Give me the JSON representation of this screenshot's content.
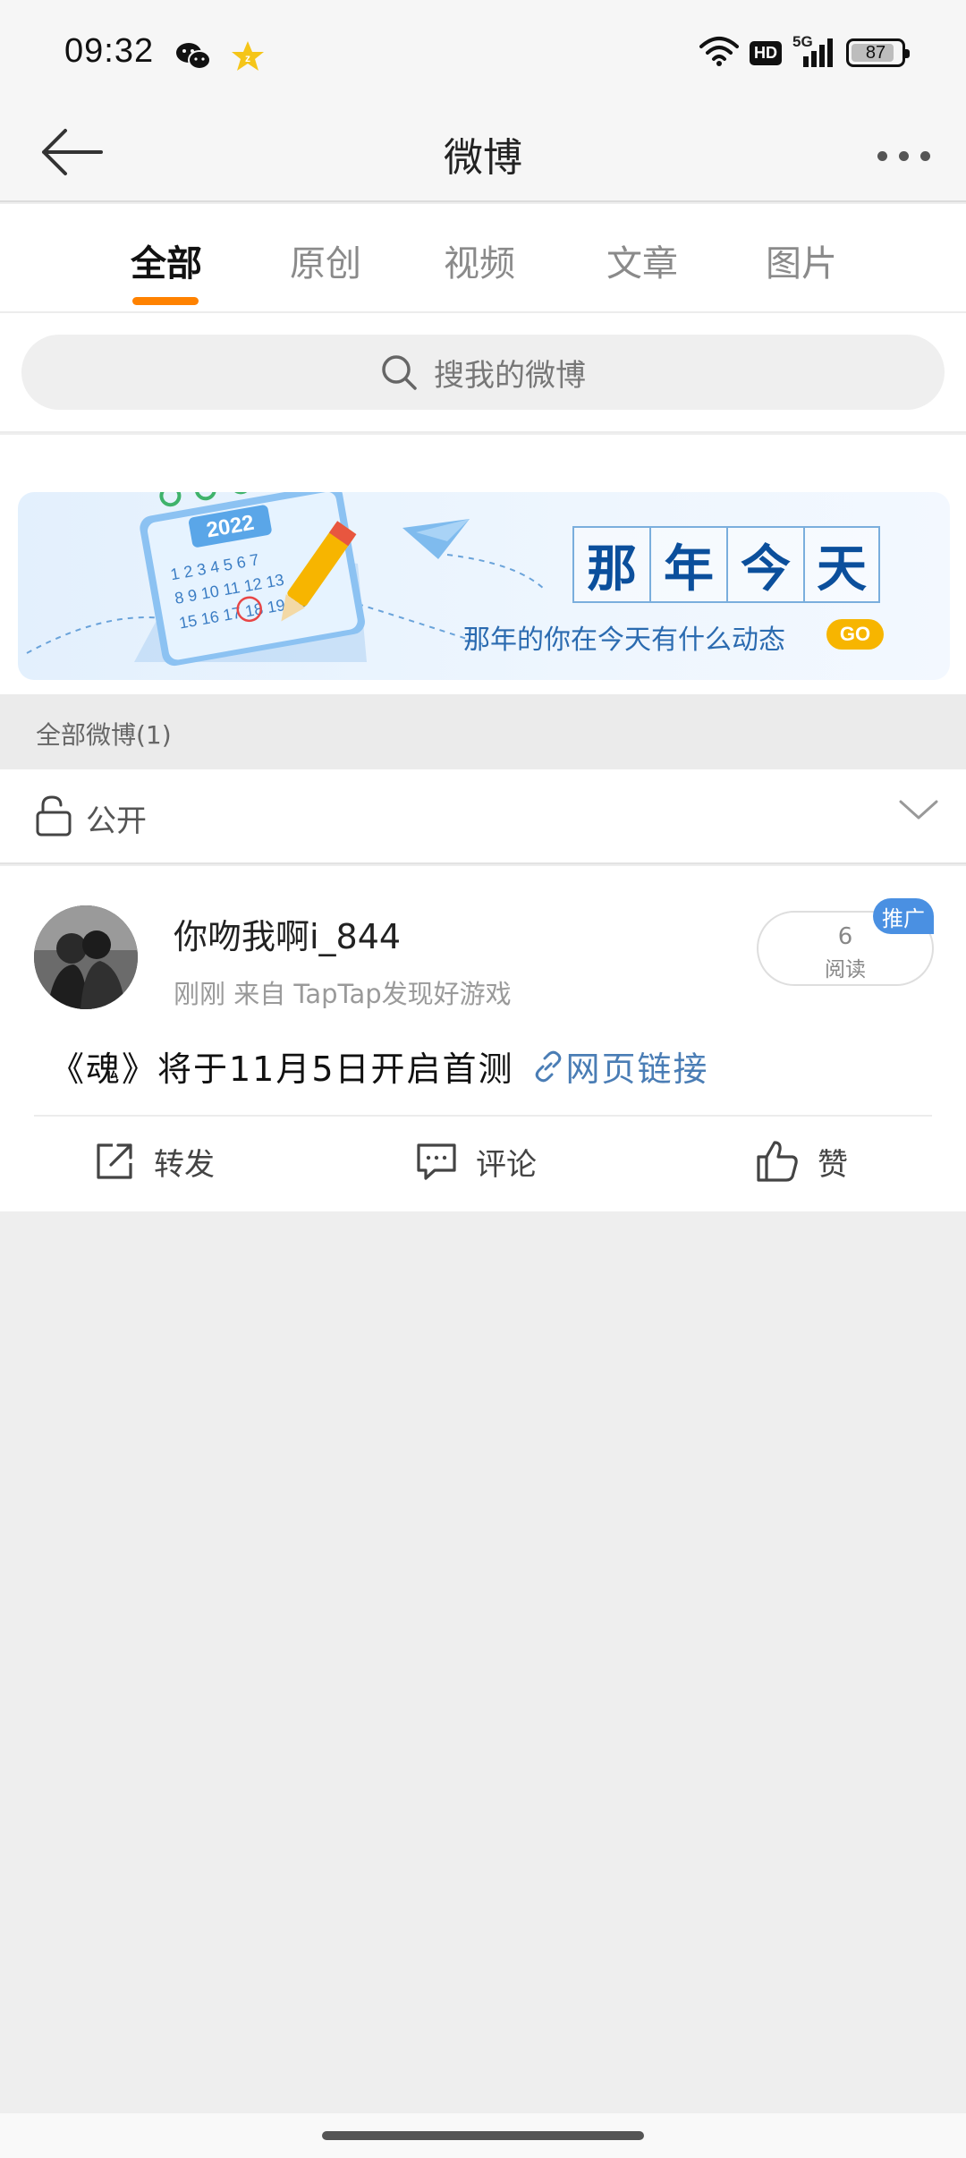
{
  "status_bar": {
    "time": "09:32",
    "hd": "HD",
    "network": "5G",
    "battery": "87",
    "battery_level": 87,
    "icons": [
      "wechat-icon",
      "star-app-icon",
      "wifi-icon",
      "hd-icon",
      "signal-5g-icon",
      "battery-icon"
    ]
  },
  "header": {
    "title": "微博",
    "back_icon": "back-arrow-icon",
    "more_icon": "more-dots-icon"
  },
  "tabs": [
    {
      "label": "全部",
      "active": true
    },
    {
      "label": "原创",
      "active": false
    },
    {
      "label": "视频",
      "active": false
    },
    {
      "label": "文章",
      "active": false
    },
    {
      "label": "图片",
      "active": false
    }
  ],
  "search": {
    "placeholder": "搜我的微博"
  },
  "banner": {
    "title_chars": [
      "那",
      "年",
      "今",
      "天"
    ],
    "calendar_year": "2022",
    "subtitle": "那年的你在今天有什么动态",
    "go": "GO",
    "accent": "#0b4f9c"
  },
  "section_header": {
    "label": "全部微博(1)"
  },
  "filter": {
    "label": "公开"
  },
  "post": {
    "username": "你吻我啊i_844",
    "meta": "刚刚  来自 TapTap发现好游戏",
    "read_count": "6",
    "read_label": "阅读",
    "promo_badge": "推广",
    "content_text": "《魂》将于11月5日开启首测",
    "link_text": "网页链接",
    "actions": [
      {
        "label": "转发",
        "icon": "share-icon"
      },
      {
        "label": "评论",
        "icon": "comment-icon"
      },
      {
        "label": "赞",
        "icon": "like-icon"
      }
    ]
  },
  "colors": {
    "accent_orange": "#ff8200",
    "link_blue": "#4a7db5",
    "promo_blue": "#4a90e2",
    "go_yellow": "#f7b500"
  }
}
